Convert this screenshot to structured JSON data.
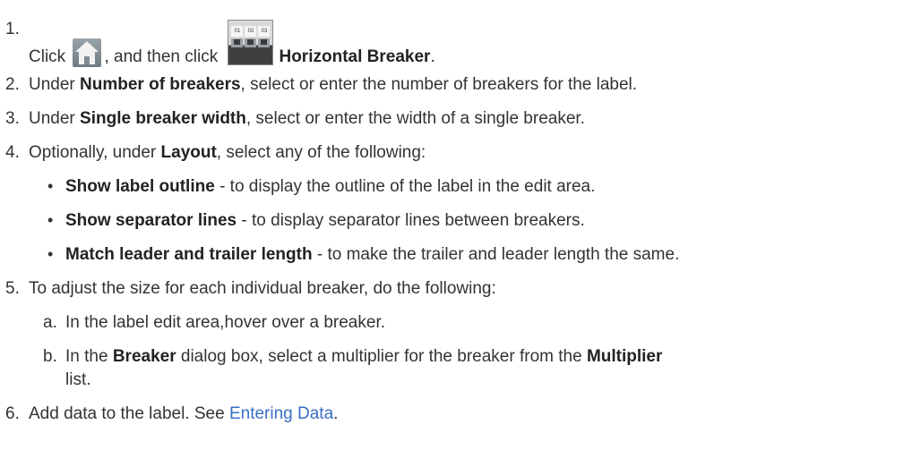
{
  "steps": {
    "s1": {
      "num": "1.",
      "t_click": "Click",
      "t_then": ", and then click",
      "b_horizontal": "Horizontal Breaker",
      "t_end": ".",
      "icon_nums": [
        "01",
        "02",
        "03"
      ]
    },
    "s2": {
      "num": "2.",
      "t_pre": "Under",
      "b_field": "Number of breakers",
      "t_post": ", select or enter the number of breakers for the label."
    },
    "s3": {
      "num": "3.",
      "t_pre": "Under",
      "b_field": "Single breaker width",
      "t_post": ", select or enter the width of a single breaker."
    },
    "s4": {
      "num": "4.",
      "t_pre": "Optionally, under",
      "b_field": "Layout",
      "t_post": ", select any of the following:",
      "bullets": [
        {
          "bullet": "•",
          "bold": "Show label outline",
          "text": " - to display the outline of the label in the edit area."
        },
        {
          "bullet": "•",
          "bold": "Show separator lines",
          "text": " - to display separator lines between breakers."
        },
        {
          "bullet": "•",
          "bold": "Match leader and trailer length",
          "text": " - to make the trailer and leader length the same."
        }
      ]
    },
    "s5": {
      "num": "5.",
      "text": "To adjust the size for each individual breaker, do the following:",
      "a": {
        "num": "a.",
        "text": "In the label edit area,hover over a breaker."
      },
      "b": {
        "num": "b.",
        "t_pre": "In the",
        "b_dialog": "Breaker",
        "t_mid": "dialog box, select a multiplier for the breaker from the",
        "b_list": "Multiplier",
        "t_wrap": "list."
      }
    },
    "s6": {
      "num": "6.",
      "t_pre": "Add data to the label. See",
      "link": "Entering Data",
      "t_end": "."
    }
  }
}
